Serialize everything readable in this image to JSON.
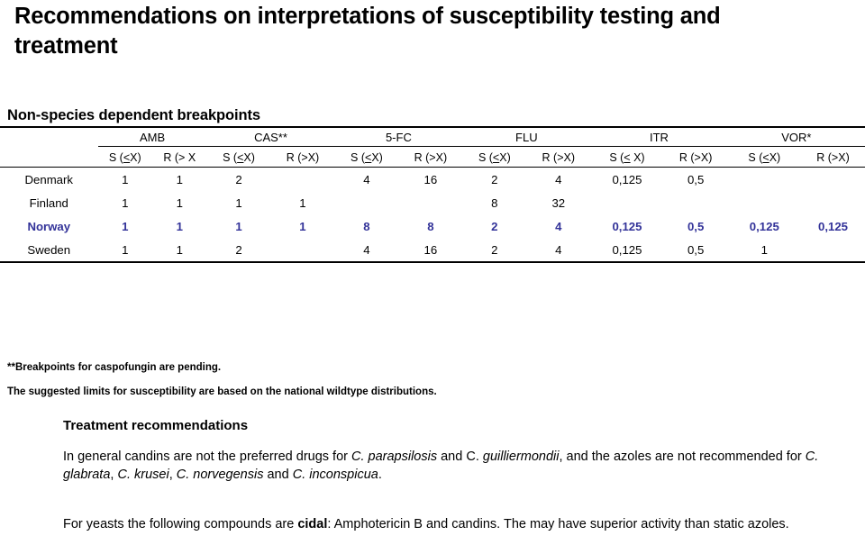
{
  "title": "Recommendations on interpretations of susceptibility testing and treatment",
  "section_heading": "Non-species dependent breakpoints",
  "table": {
    "drug_groups": [
      {
        "name": "AMB",
        "s_label": "S (<X)",
        "r_label": "R (> X"
      },
      {
        "name": "CAS**",
        "s_label": "S (<X)",
        "r_label": "R (>X)"
      },
      {
        "name": "5-FC",
        "s_label": "S (<X)",
        "r_label": "R (>X)"
      },
      {
        "name": "FLU",
        "s_label": "S (<X)",
        "r_label": "R (>X)"
      },
      {
        "name": "ITR",
        "s_label": "S (< X)",
        "r_label": "R (>X)"
      },
      {
        "name": "VOR*",
        "s_label": "S (<X)",
        "r_label": "R (>X)"
      }
    ],
    "rows": [
      {
        "country": "Denmark",
        "highlight": false,
        "values": [
          "1",
          "1",
          "2",
          "",
          "4",
          "16",
          "2",
          "4",
          "0,125",
          "0,5",
          "",
          ""
        ]
      },
      {
        "country": "Finland",
        "highlight": false,
        "values": [
          "1",
          "1",
          "1",
          "1",
          "",
          "",
          "8",
          "32",
          "",
          "",
          "",
          ""
        ]
      },
      {
        "country": "Norway",
        "highlight": true,
        "values": [
          "1",
          "1",
          "1",
          "1",
          "8",
          "8",
          "2",
          "4",
          "0,125",
          "0,5",
          "0,125",
          "0,125"
        ]
      },
      {
        "country": "Sweden",
        "highlight": false,
        "values": [
          "1",
          "1",
          "2",
          "",
          "4",
          "16",
          "2",
          "4",
          "0,125",
          "0,5",
          "1",
          ""
        ]
      }
    ],
    "highlight_color": "#333399"
  },
  "footnotes": {
    "line1_pre": "**Breakpoints for ",
    "line1_bold": "caspofungin",
    "line1_post": " are pending.",
    "line2": "The suggested limits for susceptibility are based on the national wildtype distributions."
  },
  "treatment": {
    "heading": "Treatment recommendations",
    "paragraph1": {
      "seg1": "In general candins are not the preferred drugs for ",
      "sp1": "C. parapsilosis",
      "seg2": " and C. ",
      "sp2": "guilliermondii",
      "seg3": ", and the azoles are not recommended for ",
      "sp3": "C. glabrata",
      "seg4": ", ",
      "sp4": "C. krusei",
      "seg5": ", ",
      "sp5": "C. norvegensis",
      "seg6": " and ",
      "sp6": "C. inconspicua",
      "seg7": "."
    },
    "paragraph2": {
      "seg1": "For yeasts the following compounds are ",
      "bold1": "cidal",
      "seg2": ": Amphotericin B and candins. The may have superior activity than static azoles."
    }
  }
}
